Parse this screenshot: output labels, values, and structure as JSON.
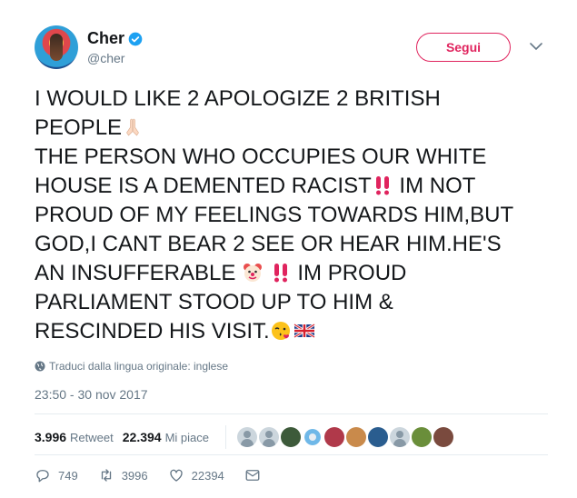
{
  "user": {
    "display_name": "Cher",
    "handle": "@cher",
    "verified": true
  },
  "follow_button": {
    "label": "Segui",
    "color": "#e0245e"
  },
  "tweet": {
    "line1": "I WOULD LIKE 2 APOLOGIZE 2 BRITISH",
    "line2": "PEOPLE",
    "line3": "THE PERSON WHO OCCUPIES OUR WHITE",
    "line4": "HOUSE IS A DEMENTED RACIST",
    "line4b": " IM NOT",
    "line5": "PROUD OF MY FEELINGS TOWARDS HIM,BUT",
    "line6": "GOD,I CANT BEAR 2 SEE OR HEAR HIM.HE'S",
    "line7": "AN INSUFFERABLE ",
    "line7b": " IM PROUD",
    "line8": "PARLIAMENT STOOD UP TO HIM &",
    "line9": "RESCINDED HIS VISIT.",
    "emojis": [
      "praying-hands",
      "double-exclamation",
      "clown-face",
      "double-exclamation",
      "face-blowing-kiss",
      "uk-flag"
    ]
  },
  "translation_note": "Traduci dalla lingua originale: inglese",
  "timestamp": "23:50 - 30 nov 2017",
  "stats": {
    "retweets_count": "3.996",
    "retweets_label": "Retweet",
    "likes_count": "22.394",
    "likes_label": "Mi piace"
  },
  "actions": {
    "replies": "749",
    "retweets": "3996",
    "likes": "22394"
  },
  "colors": {
    "text": "#14171a",
    "secondary": "#657786",
    "verified": "#1da1f2",
    "divider": "#e6ecf0"
  }
}
